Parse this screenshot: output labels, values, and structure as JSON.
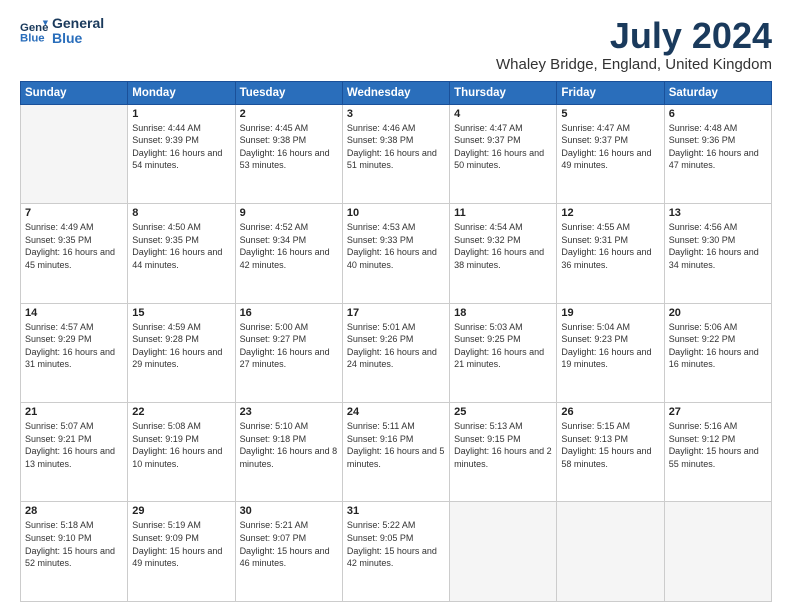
{
  "logo": {
    "line1": "General",
    "line2": "Blue"
  },
  "title": "July 2024",
  "location": "Whaley Bridge, England, United Kingdom",
  "days_of_week": [
    "Sunday",
    "Monday",
    "Tuesday",
    "Wednesday",
    "Thursday",
    "Friday",
    "Saturday"
  ],
  "weeks": [
    [
      {
        "day": "",
        "sunrise": "",
        "sunset": "",
        "daylight": "",
        "empty": true
      },
      {
        "day": "1",
        "sunrise": "Sunrise: 4:44 AM",
        "sunset": "Sunset: 9:39 PM",
        "daylight": "Daylight: 16 hours and 54 minutes."
      },
      {
        "day": "2",
        "sunrise": "Sunrise: 4:45 AM",
        "sunset": "Sunset: 9:38 PM",
        "daylight": "Daylight: 16 hours and 53 minutes."
      },
      {
        "day": "3",
        "sunrise": "Sunrise: 4:46 AM",
        "sunset": "Sunset: 9:38 PM",
        "daylight": "Daylight: 16 hours and 51 minutes."
      },
      {
        "day": "4",
        "sunrise": "Sunrise: 4:47 AM",
        "sunset": "Sunset: 9:37 PM",
        "daylight": "Daylight: 16 hours and 50 minutes."
      },
      {
        "day": "5",
        "sunrise": "Sunrise: 4:47 AM",
        "sunset": "Sunset: 9:37 PM",
        "daylight": "Daylight: 16 hours and 49 minutes."
      },
      {
        "day": "6",
        "sunrise": "Sunrise: 4:48 AM",
        "sunset": "Sunset: 9:36 PM",
        "daylight": "Daylight: 16 hours and 47 minutes."
      }
    ],
    [
      {
        "day": "7",
        "sunrise": "Sunrise: 4:49 AM",
        "sunset": "Sunset: 9:35 PM",
        "daylight": "Daylight: 16 hours and 45 minutes."
      },
      {
        "day": "8",
        "sunrise": "Sunrise: 4:50 AM",
        "sunset": "Sunset: 9:35 PM",
        "daylight": "Daylight: 16 hours and 44 minutes."
      },
      {
        "day": "9",
        "sunrise": "Sunrise: 4:52 AM",
        "sunset": "Sunset: 9:34 PM",
        "daylight": "Daylight: 16 hours and 42 minutes."
      },
      {
        "day": "10",
        "sunrise": "Sunrise: 4:53 AM",
        "sunset": "Sunset: 9:33 PM",
        "daylight": "Daylight: 16 hours and 40 minutes."
      },
      {
        "day": "11",
        "sunrise": "Sunrise: 4:54 AM",
        "sunset": "Sunset: 9:32 PM",
        "daylight": "Daylight: 16 hours and 38 minutes."
      },
      {
        "day": "12",
        "sunrise": "Sunrise: 4:55 AM",
        "sunset": "Sunset: 9:31 PM",
        "daylight": "Daylight: 16 hours and 36 minutes."
      },
      {
        "day": "13",
        "sunrise": "Sunrise: 4:56 AM",
        "sunset": "Sunset: 9:30 PM",
        "daylight": "Daylight: 16 hours and 34 minutes."
      }
    ],
    [
      {
        "day": "14",
        "sunrise": "Sunrise: 4:57 AM",
        "sunset": "Sunset: 9:29 PM",
        "daylight": "Daylight: 16 hours and 31 minutes."
      },
      {
        "day": "15",
        "sunrise": "Sunrise: 4:59 AM",
        "sunset": "Sunset: 9:28 PM",
        "daylight": "Daylight: 16 hours and 29 minutes."
      },
      {
        "day": "16",
        "sunrise": "Sunrise: 5:00 AM",
        "sunset": "Sunset: 9:27 PM",
        "daylight": "Daylight: 16 hours and 27 minutes."
      },
      {
        "day": "17",
        "sunrise": "Sunrise: 5:01 AM",
        "sunset": "Sunset: 9:26 PM",
        "daylight": "Daylight: 16 hours and 24 minutes."
      },
      {
        "day": "18",
        "sunrise": "Sunrise: 5:03 AM",
        "sunset": "Sunset: 9:25 PM",
        "daylight": "Daylight: 16 hours and 21 minutes."
      },
      {
        "day": "19",
        "sunrise": "Sunrise: 5:04 AM",
        "sunset": "Sunset: 9:23 PM",
        "daylight": "Daylight: 16 hours and 19 minutes."
      },
      {
        "day": "20",
        "sunrise": "Sunrise: 5:06 AM",
        "sunset": "Sunset: 9:22 PM",
        "daylight": "Daylight: 16 hours and 16 minutes."
      }
    ],
    [
      {
        "day": "21",
        "sunrise": "Sunrise: 5:07 AM",
        "sunset": "Sunset: 9:21 PM",
        "daylight": "Daylight: 16 hours and 13 minutes."
      },
      {
        "day": "22",
        "sunrise": "Sunrise: 5:08 AM",
        "sunset": "Sunset: 9:19 PM",
        "daylight": "Daylight: 16 hours and 10 minutes."
      },
      {
        "day": "23",
        "sunrise": "Sunrise: 5:10 AM",
        "sunset": "Sunset: 9:18 PM",
        "daylight": "Daylight: 16 hours and 8 minutes."
      },
      {
        "day": "24",
        "sunrise": "Sunrise: 5:11 AM",
        "sunset": "Sunset: 9:16 PM",
        "daylight": "Daylight: 16 hours and 5 minutes."
      },
      {
        "day": "25",
        "sunrise": "Sunrise: 5:13 AM",
        "sunset": "Sunset: 9:15 PM",
        "daylight": "Daylight: 16 hours and 2 minutes."
      },
      {
        "day": "26",
        "sunrise": "Sunrise: 5:15 AM",
        "sunset": "Sunset: 9:13 PM",
        "daylight": "Daylight: 15 hours and 58 minutes."
      },
      {
        "day": "27",
        "sunrise": "Sunrise: 5:16 AM",
        "sunset": "Sunset: 9:12 PM",
        "daylight": "Daylight: 15 hours and 55 minutes."
      }
    ],
    [
      {
        "day": "28",
        "sunrise": "Sunrise: 5:18 AM",
        "sunset": "Sunset: 9:10 PM",
        "daylight": "Daylight: 15 hours and 52 minutes."
      },
      {
        "day": "29",
        "sunrise": "Sunrise: 5:19 AM",
        "sunset": "Sunset: 9:09 PM",
        "daylight": "Daylight: 15 hours and 49 minutes."
      },
      {
        "day": "30",
        "sunrise": "Sunrise: 5:21 AM",
        "sunset": "Sunset: 9:07 PM",
        "daylight": "Daylight: 15 hours and 46 minutes."
      },
      {
        "day": "31",
        "sunrise": "Sunrise: 5:22 AM",
        "sunset": "Sunset: 9:05 PM",
        "daylight": "Daylight: 15 hours and 42 minutes."
      },
      {
        "day": "",
        "sunrise": "",
        "sunset": "",
        "daylight": "",
        "empty": true
      },
      {
        "day": "",
        "sunrise": "",
        "sunset": "",
        "daylight": "",
        "empty": true
      },
      {
        "day": "",
        "sunrise": "",
        "sunset": "",
        "daylight": "",
        "empty": true
      }
    ]
  ]
}
